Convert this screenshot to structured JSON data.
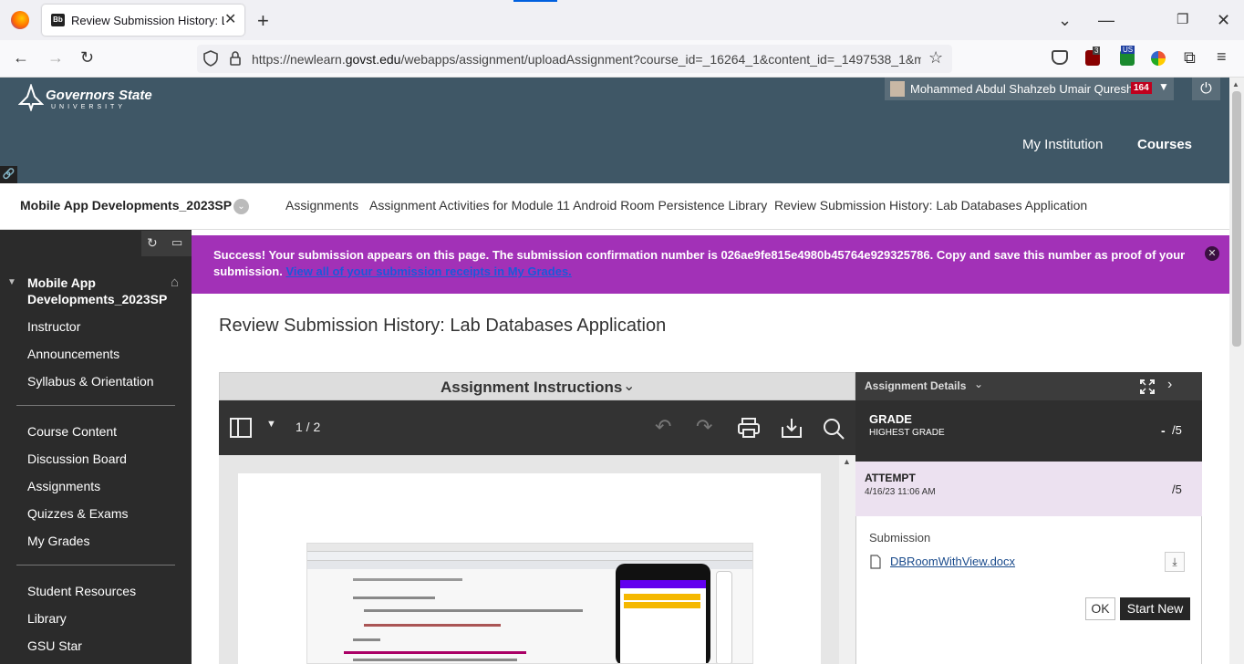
{
  "browser": {
    "tab_title": "Review Submission History: Lab",
    "new_tab": "+",
    "url_prefix": "https://newlearn.",
    "url_domain": "govst.edu",
    "url_path": "/webapps/assignment/uploadAssignment?course_id=_16264_1&content_id=_1497538_1&m",
    "ext_badge_1": "3",
    "ext_badge_2": "US"
  },
  "header": {
    "logo_name": "Governors State",
    "logo_sub": "UNIVERSITY",
    "user_name": "Mohammed Abdul Shahzeb Umair Qureshi",
    "notification_count": "164",
    "nav_my_institution": "My Institution",
    "nav_courses": "Courses"
  },
  "breadcrumb": {
    "course": "Mobile App Developments_2023SP",
    "items": [
      "Assignments",
      "Assignment Activities for Module 11 Android Room Persistence Library",
      "Review Submission History: Lab Databases Application"
    ]
  },
  "sidebar": {
    "course_title_line1": "Mobile App",
    "course_title_line2": "Developments_2023SP",
    "group1": [
      "Instructor",
      "Announcements",
      "Syllabus & Orientation"
    ],
    "group2": [
      "Course Content",
      "Discussion Board",
      "Assignments",
      "Quizzes & Exams",
      "My Grades"
    ],
    "group3": [
      "Student Resources",
      "Library",
      "GSU Star"
    ]
  },
  "banner": {
    "message": "Success! Your submission appears on this page. The submission confirmation number is 026ae9fe815e4980b45764e929325786. Copy and save this number as proof of your submission.",
    "link": "View all of your submission receipts in My Grades."
  },
  "page": {
    "title": "Review Submission History: Lab Databases Application"
  },
  "viewer": {
    "header": "Assignment Instructions",
    "page_indicator": "1 / 2"
  },
  "details": {
    "header": "Assignment Details",
    "grade_label": "GRADE",
    "grade_sub": "HIGHEST GRADE",
    "grade_value": "-",
    "grade_max": "/5",
    "attempt_label": "ATTEMPT",
    "attempt_date": "4/16/23 11:06 AM",
    "attempt_max": "/5",
    "submission_label": "Submission",
    "file_name": "DBRoomWithView.docx",
    "ok_button": "OK",
    "start_new_button": "Start New"
  }
}
